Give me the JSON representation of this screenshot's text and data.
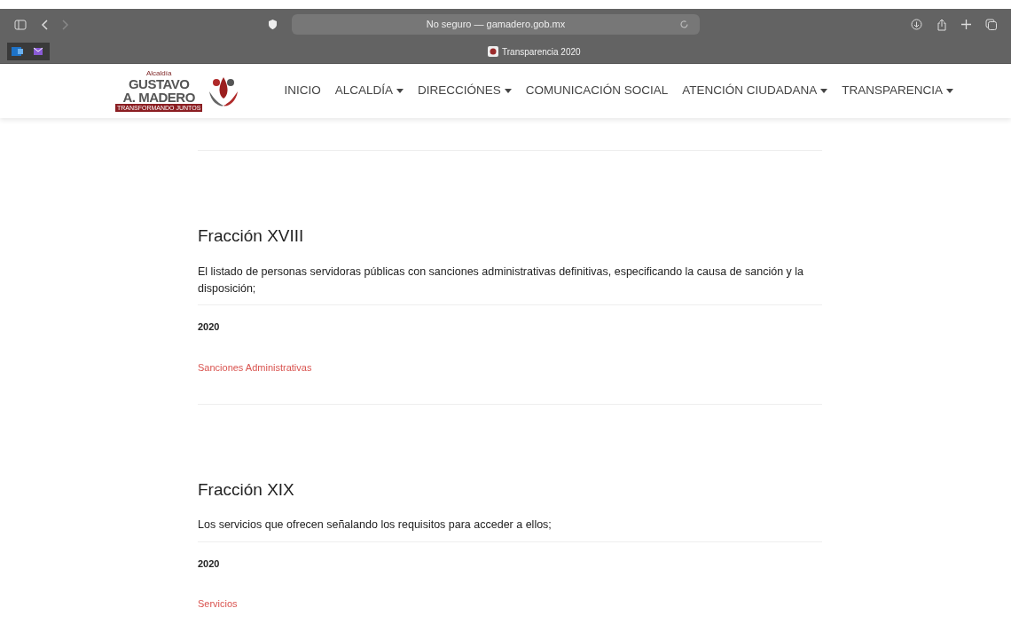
{
  "browser": {
    "address": "No seguro — gamadero.gob.mx",
    "tab_title": "Transparencia 2020"
  },
  "site": {
    "logo": {
      "top": "Alcaldía",
      "line1": "GUSTAVO",
      "line2": "A. MADERO",
      "tagline": "TRANSFORMANDO JUNTOS"
    },
    "nav": [
      {
        "label": "INICIO",
        "dropdown": false
      },
      {
        "label": "ALCALDÍA",
        "dropdown": true
      },
      {
        "label": "DIRECCIÓNES",
        "dropdown": true
      },
      {
        "label": "COMUNICACIÓN SOCIAL",
        "dropdown": false
      },
      {
        "label": "ATENCIÓN CIUDADANA",
        "dropdown": true
      },
      {
        "label": "TRANSPARENCIA",
        "dropdown": true
      }
    ]
  },
  "sections": [
    {
      "title": "Fracción XVIII",
      "description": "El listado de personas servidoras públicas con sanciones administrativas definitivas, especificando la causa de sanción y la disposición;",
      "year": "2020",
      "link": "Sanciones Administrativas"
    },
    {
      "title": "Fracción XIX",
      "description": "Los servicios que ofrecen señalando los requisitos para acceder a ellos;",
      "year": "2020",
      "link": "Servicios"
    }
  ]
}
